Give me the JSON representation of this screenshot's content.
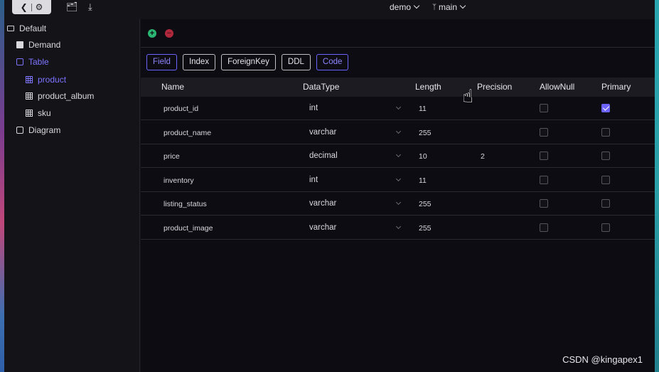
{
  "topbar": {
    "back_icon": "chevron-left-icon",
    "settings_icon": "gear-icon",
    "folder_icon": "folder-settings-icon",
    "download_icon": "download-icon",
    "project": "demo",
    "branch": "main"
  },
  "sidebar": {
    "root": "Default",
    "items": [
      {
        "label": "Demand",
        "icon": "document-icon"
      },
      {
        "label": "Table",
        "icon": "table-icon"
      },
      {
        "label": "product",
        "icon": "grid-icon"
      },
      {
        "label": "product_album",
        "icon": "grid-icon"
      },
      {
        "label": "sku",
        "icon": "grid-icon"
      },
      {
        "label": "Diagram",
        "icon": "diagram-icon"
      }
    ]
  },
  "toolbar": {
    "add_label": "+",
    "remove_label": "−"
  },
  "tabs": [
    "Field",
    "Index",
    "ForeignKey",
    "DDL",
    "Code"
  ],
  "table": {
    "headers": [
      "Name",
      "DataType",
      "Length",
      "Precision",
      "AllowNull",
      "Primary"
    ],
    "rows": [
      {
        "name": "product_id",
        "type": "int",
        "length": "11",
        "precision": "",
        "allow_null": false,
        "primary": true
      },
      {
        "name": "product_name",
        "type": "varchar",
        "length": "255",
        "precision": "",
        "allow_null": false,
        "primary": false
      },
      {
        "name": "price",
        "type": "decimal",
        "length": "10",
        "precision": "2",
        "allow_null": false,
        "primary": false
      },
      {
        "name": "inventory",
        "type": "int",
        "length": "11",
        "precision": "",
        "allow_null": false,
        "primary": false
      },
      {
        "name": "listing_status",
        "type": "varchar",
        "length": "255",
        "precision": "",
        "allow_null": false,
        "primary": false
      },
      {
        "name": "product_image",
        "type": "varchar",
        "length": "255",
        "precision": "",
        "allow_null": false,
        "primary": false
      }
    ]
  },
  "watermark": "CSDN @kingapex1",
  "colors": {
    "accent": "#6d63ff",
    "add": "#2bb673",
    "remove": "#b0283c"
  }
}
